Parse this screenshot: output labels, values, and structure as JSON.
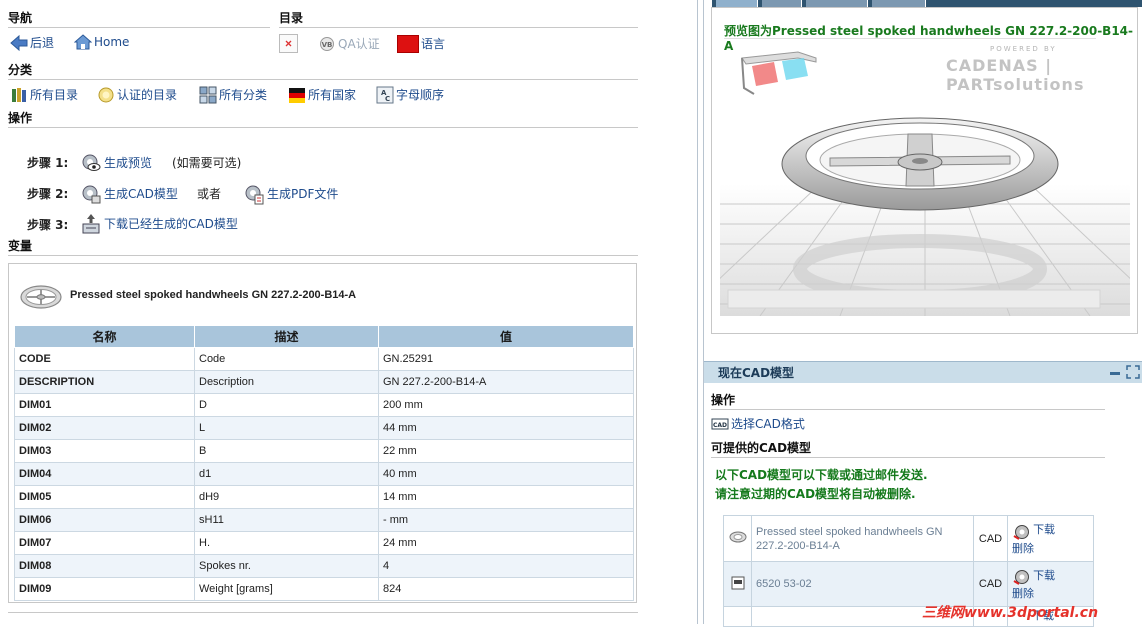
{
  "nav": {
    "title": "导航",
    "back_label": "后退",
    "home_label": "Home"
  },
  "catalog": {
    "title": "目录",
    "qa_label": "QA认证",
    "lang_label": "语言"
  },
  "category": {
    "title": "分类",
    "items": [
      {
        "label": "所有目录"
      },
      {
        "label": "认证的目录"
      },
      {
        "label": "所有分类"
      },
      {
        "label": "所有国家"
      },
      {
        "label": "字母顺序"
      }
    ]
  },
  "actions": {
    "title": "操作",
    "step1_label": "步骤 1:",
    "step1_link": "生成预览",
    "step1_note": "(如需要可选)",
    "step2_label": "步骤 2:",
    "step2_link": "生成CAD模型",
    "step2_or": "或者",
    "step2_pdf": "生成PDF文件",
    "step3_label": "步骤 3:",
    "step3_link": "下载已经生成的CAD模型"
  },
  "variant": {
    "title": "变量",
    "product_name": "Pressed steel spoked handwheels GN 227.2-200-B14-A",
    "headers": [
      "名称",
      "描述",
      "值"
    ],
    "rows": [
      {
        "name": "CODE",
        "desc": "Code",
        "value": "GN.25291"
      },
      {
        "name": "DESCRIPTION",
        "desc": "Description",
        "value": "GN 227.2-200-B14-A"
      },
      {
        "name": "DIM01",
        "desc": "D",
        "value": "200 mm"
      },
      {
        "name": "DIM02",
        "desc": "L",
        "value": "44 mm"
      },
      {
        "name": "DIM03",
        "desc": "B",
        "value": "22 mm"
      },
      {
        "name": "DIM04",
        "desc": "d1",
        "value": "40 mm"
      },
      {
        "name": "DIM05",
        "desc": "dH9",
        "value": "14 mm"
      },
      {
        "name": "DIM06",
        "desc": "sH11",
        "value": "- mm"
      },
      {
        "name": "DIM07",
        "desc": "H.",
        "value": "24 mm"
      },
      {
        "name": "DIM08",
        "desc": "Spokes nr.",
        "value": "4"
      },
      {
        "name": "DIM09",
        "desc": "Weight [grams]",
        "value": "824"
      }
    ]
  },
  "preview": {
    "title": "预览图为Pressed steel spoked handwheels GN 227.2-200-B14-A",
    "brand_powered": "POWERED BY",
    "brand_main": "CADENAS | PARTsolutions"
  },
  "cad": {
    "header": "现在CAD模型",
    "ops_title": "操作",
    "select_format": "选择CAD格式",
    "available_title": "可提供的CAD模型",
    "note_line1": "以下CAD模型可以下载或通过邮件发送.",
    "note_line2": "请注意过期的CAD模型将自动被删除.",
    "rows": [
      {
        "name": "Pressed steel spoked handwheels GN 227.2-200-B14-A",
        "type": "CAD",
        "download": "下载",
        "delete": "删除"
      },
      {
        "name": "6520 53-02",
        "type": "CAD",
        "download": "下载",
        "delete": "删除"
      },
      {
        "name": "",
        "type": "",
        "download": "下载",
        "delete": ""
      }
    ]
  },
  "watermark": "三维网www.3dportal.cn"
}
